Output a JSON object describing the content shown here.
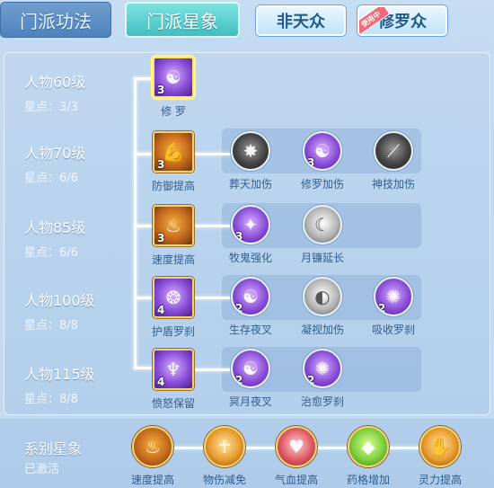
{
  "tabs": [
    {
      "label": "门派功法",
      "state": "normal"
    },
    {
      "label": "门派星象",
      "state": "active"
    },
    {
      "label": "非天众",
      "state": "light"
    },
    {
      "label": "修罗众",
      "state": "light",
      "ribbon": "使用中"
    }
  ],
  "tiers": [
    {
      "title": "人物60级",
      "stars": "星点：3/3",
      "main": {
        "name": "修 罗",
        "count": "3",
        "icon": "shura-face-icon"
      },
      "subs": []
    },
    {
      "title": "人物70级",
      "stars": "星点：6/6",
      "main": {
        "name": "防御提高",
        "count": "3",
        "icon": "flexed-arm-icon"
      },
      "subs": [
        {
          "name": "葬天加伤",
          "count": "",
          "icon": "dark-burst-icon"
        },
        {
          "name": "修罗加伤",
          "count": "3",
          "icon": "shura-face-icon"
        },
        {
          "name": "神技加伤",
          "count": "",
          "icon": "claw-strike-icon"
        }
      ]
    },
    {
      "title": "人物85级",
      "stars": "星点：6/6",
      "main": {
        "name": "速度提高",
        "count": "3",
        "icon": "flame-speed-icon"
      },
      "subs": [
        {
          "name": "牧鬼强化",
          "count": "3",
          "icon": "golden-chest-icon"
        },
        {
          "name": "月镰延长",
          "count": "",
          "icon": "crescent-blade-icon"
        }
      ]
    },
    {
      "title": "人物100级",
      "stars": "星点：8/8",
      "main": {
        "name": "护盾罗刹",
        "count": "4",
        "icon": "spirit-shield-icon"
      },
      "subs": [
        {
          "name": "生存夜叉",
          "count": "2",
          "icon": "shura-face-icon"
        },
        {
          "name": "凝视加伤",
          "count": "",
          "icon": "moon-gaze-icon"
        },
        {
          "name": "吸收罗刹",
          "count": "2",
          "icon": "spirit-orb-icon"
        }
      ]
    },
    {
      "title": "人物115级",
      "stars": "星点：8/8",
      "main": {
        "name": "愤怒保留",
        "count": "4",
        "icon": "winged-demon-icon"
      },
      "subs": [
        {
          "name": "冥月夜叉",
          "count": "2",
          "icon": "shura-face-icon"
        },
        {
          "name": "治愈罗刹",
          "count": "2",
          "icon": "spirit-orb-icon"
        }
      ]
    }
  ],
  "series": {
    "title": "系别星象",
    "status": "已激活",
    "skills": [
      {
        "name": "速度提高",
        "icon": "flame-speed-icon"
      },
      {
        "name": "物伤减免",
        "icon": "golden-figure-icon"
      },
      {
        "name": "气血提高",
        "icon": "heart-icon"
      },
      {
        "name": "药格增加",
        "icon": "green-gem-icon"
      },
      {
        "name": "灵力提高",
        "icon": "glowing-hand-icon"
      }
    ]
  }
}
